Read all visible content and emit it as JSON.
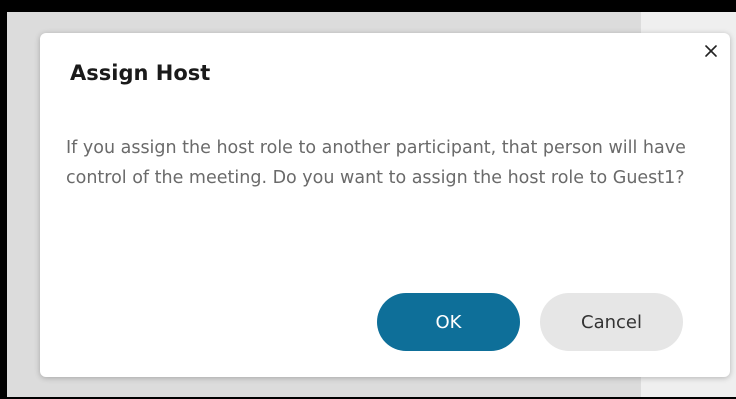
{
  "dialog": {
    "title": "Assign Host",
    "message": "If you assign the host role to another participant, that person will have control of the meeting. Do you want to assign the host role to Guest1?",
    "close_icon": "close-icon",
    "buttons": {
      "ok_label": "OK",
      "cancel_label": "Cancel"
    }
  },
  "colors": {
    "primary_button": "#0e6f99",
    "secondary_button": "#e6e6e6",
    "title_text": "#1a1a1a",
    "body_text": "#6a6a6a"
  }
}
